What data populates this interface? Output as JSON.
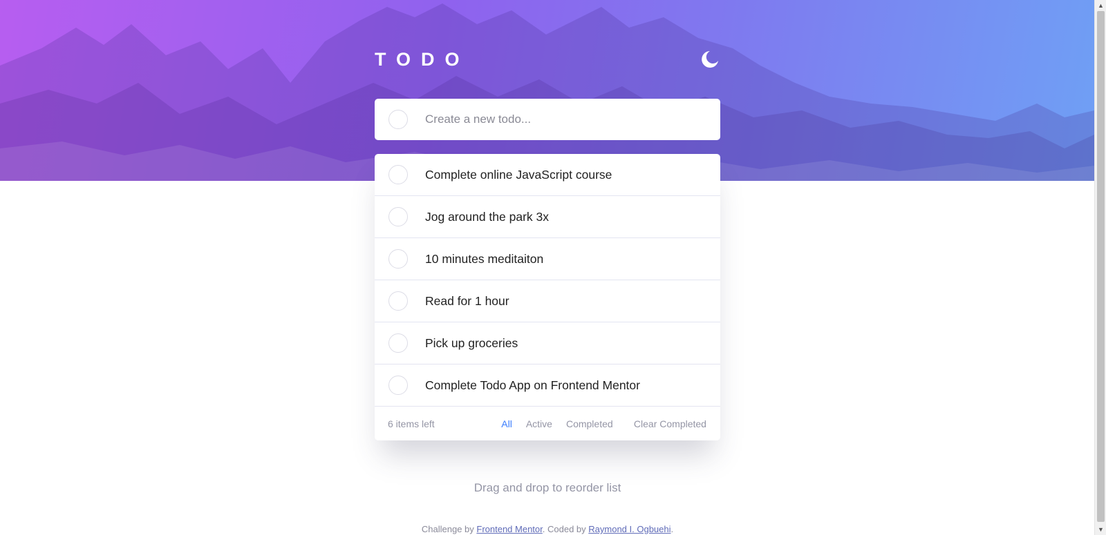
{
  "header": {
    "title": "TODO",
    "theme_icon": "moon-icon"
  },
  "new_todo": {
    "placeholder": "Create a new todo..."
  },
  "todos": [
    {
      "text": "Complete online JavaScript course",
      "completed": false
    },
    {
      "text": "Jog around the park 3x",
      "completed": false
    },
    {
      "text": "10 minutes meditaiton",
      "completed": false
    },
    {
      "text": "Read for 1 hour",
      "completed": false
    },
    {
      "text": "Pick up groceries",
      "completed": false
    },
    {
      "text": "Complete Todo App on Frontend Mentor",
      "completed": false
    }
  ],
  "footer": {
    "items_left": "6 items left",
    "filters": [
      "All",
      "Active",
      "Completed"
    ],
    "active_filter": "All",
    "clear_label": "Clear Completed"
  },
  "drag_hint": "Drag and drop to reorder list",
  "attribution": {
    "prefix": "Challenge by ",
    "challenge_link": "Frontend Mentor",
    "middle": ". Coded by ",
    "author_link": "Raymond I. Ogbuehi",
    "suffix": "."
  },
  "colors": {
    "gradient_start": "#b75ef0",
    "gradient_end": "#6fa0f5",
    "active_filter": "#3a7cfd",
    "muted_text": "#9495a5"
  }
}
